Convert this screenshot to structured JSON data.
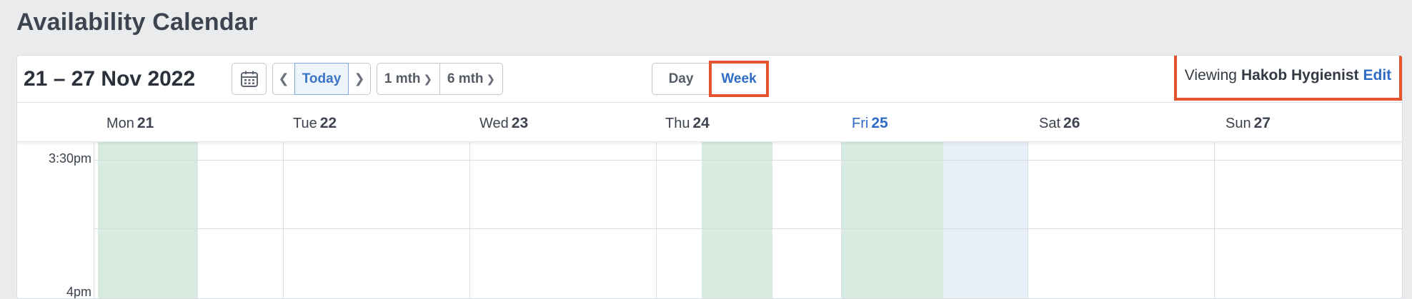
{
  "page": {
    "title": "Availability Calendar"
  },
  "toolbar": {
    "date_range": "21 – 27 Nov 2022",
    "calendar_icon": "calendar-icon",
    "prev_icon": "chevron-left-icon",
    "next_icon": "chevron-right-icon",
    "today_label": "Today",
    "mth1_label": "1 mth",
    "mth6_label": "6 mth",
    "day_label": "Day",
    "week_label": "Week",
    "viewing_prefix": "Viewing",
    "viewing_name": "Hakob Hygienist",
    "edit_label": "Edit"
  },
  "days": [
    {
      "dow": "Mon",
      "num": "21"
    },
    {
      "dow": "Tue",
      "num": "22"
    },
    {
      "dow": "Wed",
      "num": "23"
    },
    {
      "dow": "Thu",
      "num": "24"
    },
    {
      "dow": "Fri",
      "num": "25",
      "today": true
    },
    {
      "dow": "Sat",
      "num": "26"
    },
    {
      "dow": "Sun",
      "num": "27"
    }
  ],
  "times": [
    "3:30pm",
    "4pm"
  ],
  "colors": {
    "accent": "#2f6cc6",
    "highlight_border": "#e5532f",
    "available_fill": "#d7ebe1",
    "today_fill": "#e8f0fa"
  }
}
